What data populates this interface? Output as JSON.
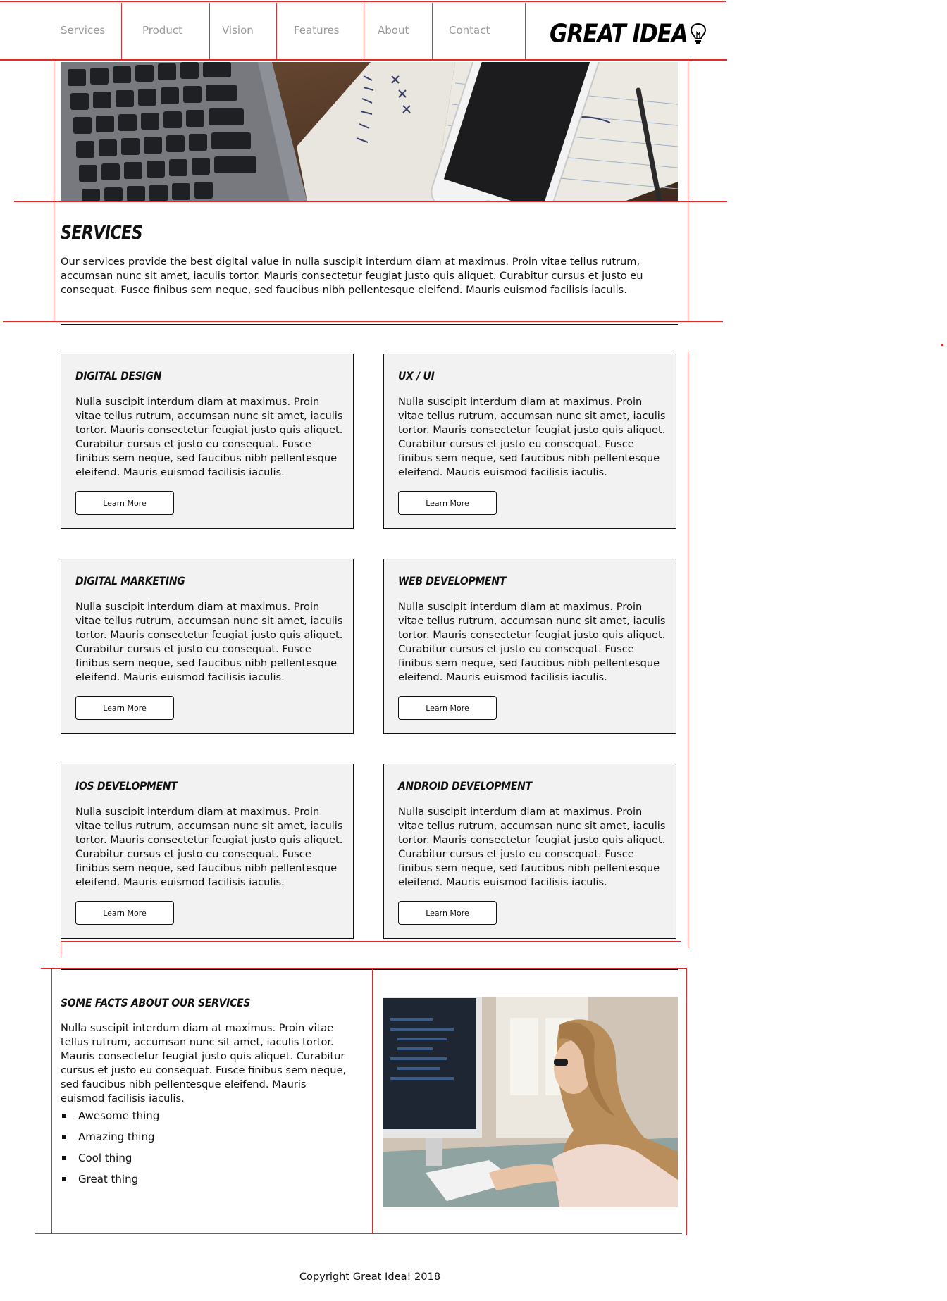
{
  "nav": {
    "items": [
      {
        "label": "Services"
      },
      {
        "label": "Product"
      },
      {
        "label": "Vision"
      },
      {
        "label": "Features"
      },
      {
        "label": "About"
      },
      {
        "label": "Contact"
      }
    ],
    "logo_text": "GREAT IDEA",
    "logo_icon": "lightbulb-icon"
  },
  "hero": {
    "image": "desk-with-laptop-phone-notebook"
  },
  "services": {
    "title": "SERVICES",
    "intro": "Our services provide the best digital value in nulla suscipit interdum diam at maximus. Proin vitae tellus rutrum, accumsan nunc sit amet, iaculis tortor. Mauris consectetur feugiat justo quis aliquet. Curabitur cursus et justo eu consequat. Fusce finibus sem neque, sed faucibus nibh pellentesque eleifend. Mauris euismod facilisis iaculis."
  },
  "cards": [
    {
      "title": "Digital Design",
      "text": "Nulla suscipit interdum diam at maximus. Proin vitae tellus rutrum, accumsan nunc sit amet, iaculis tortor. Mauris consectetur feugiat justo quis aliquet. Curabitur cursus et justo eu consequat. Fusce finibus sem neque, sed faucibus nibh pellentesque eleifend. Mauris euismod facilisis iaculis.",
      "button": "Learn More"
    },
    {
      "title": "UX / UI",
      "text": "Nulla suscipit interdum diam at maximus. Proin vitae tellus rutrum, accumsan nunc sit amet, iaculis tortor. Mauris consectetur feugiat justo quis aliquet. Curabitur cursus et justo eu consequat. Fusce finibus sem neque, sed faucibus nibh pellentesque eleifend. Mauris euismod facilisis iaculis.",
      "button": "Learn More"
    },
    {
      "title": "Digital Marketing",
      "text": "Nulla suscipit interdum diam at maximus. Proin vitae tellus rutrum, accumsan nunc sit amet, iaculis tortor. Mauris consectetur feugiat justo quis aliquet. Curabitur cursus et justo eu consequat. Fusce finibus sem neque, sed faucibus nibh pellentesque eleifend. Mauris euismod facilisis iaculis.",
      "button": "Learn More"
    },
    {
      "title": "Web Development",
      "text": "Nulla suscipit interdum diam at maximus. Proin vitae tellus rutrum, accumsan nunc sit amet, iaculis tortor. Mauris consectetur feugiat justo quis aliquet. Curabitur cursus et justo eu consequat. Fusce finibus sem neque, sed faucibus nibh pellentesque eleifend. Mauris euismod facilisis iaculis.",
      "button": "Learn More"
    },
    {
      "title": "iOS Development",
      "text": "Nulla suscipit interdum diam at maximus. Proin vitae tellus rutrum, accumsan nunc sit amet, iaculis tortor. Mauris consectetur feugiat justo quis aliquet. Curabitur cursus et justo eu consequat. Fusce finibus sem neque, sed faucibus nibh pellentesque eleifend. Mauris euismod facilisis iaculis.",
      "button": "Learn More"
    },
    {
      "title": "Android Development",
      "text": "Nulla suscipit interdum diam at maximus. Proin vitae tellus rutrum, accumsan nunc sit amet, iaculis tortor. Mauris consectetur feugiat justo quis aliquet. Curabitur cursus et justo eu consequat. Fusce finibus sem neque, sed faucibus nibh pellentesque eleifend. Mauris euismod facilisis iaculis.",
      "button": "Learn More"
    }
  ],
  "facts": {
    "title": "Some facts about our services",
    "text": "Nulla suscipit interdum diam at maximus. Proin vitae tellus rutrum, accumsan nunc sit amet, iaculis tortor. Mauris consectetur feugiat justo quis aliquet. Curabitur cursus et justo eu consequat. Fusce finibus sem neque, sed faucibus nibh pellentesque eleifend. Mauris euismod facilisis iaculis.",
    "items": [
      "Awesome thing",
      "Amazing thing",
      "Cool thing",
      "Great thing"
    ],
    "image": "woman-coding-at-computer"
  },
  "footer": {
    "copyright": "Copyright Great Idea! 2018"
  },
  "colors": {
    "guide": "#e02b2b",
    "card_bg": "#f2f2f2",
    "nav_text": "#9a9a9a"
  }
}
